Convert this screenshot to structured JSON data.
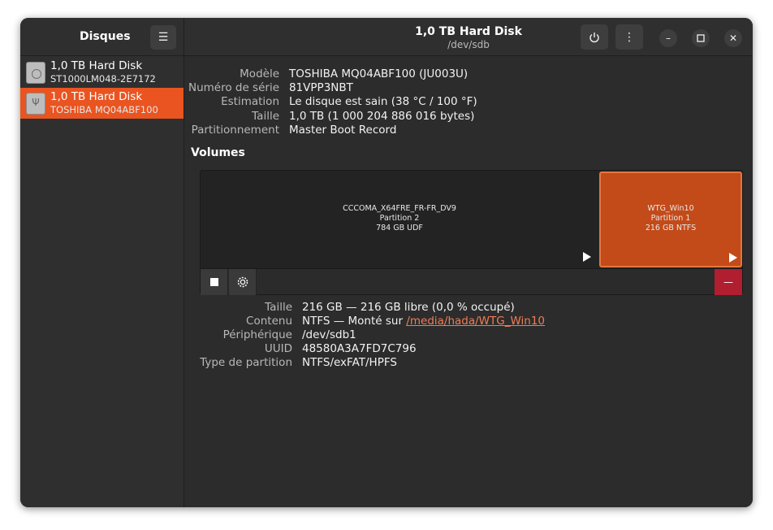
{
  "sidebar": {
    "title": "Disques",
    "menu_icon": "hamburger-icon",
    "disks": [
      {
        "name": "1,0 TB Hard Disk",
        "model": "ST1000LM048-2E7172",
        "icon": "harddisk-icon",
        "selected": false
      },
      {
        "name": "1,0 TB Hard Disk",
        "model": "TOSHIBA MQ04ABF100",
        "icon": "usb-disk-icon",
        "selected": true
      }
    ]
  },
  "header": {
    "title": "1,0 TB Hard Disk",
    "subtitle": "/dev/sdb",
    "power_icon": "power-icon",
    "menu_icon": "kebab-menu-icon",
    "minimize_icon": "minimize-icon",
    "maximize_icon": "maximize-icon",
    "close_icon": "close-icon"
  },
  "disk_info": {
    "model_label": "Modèle",
    "model_value": "TOSHIBA MQ04ABF100 (JU003U)",
    "serial_label": "Numéro de série",
    "serial_value": "81VPP3NBT",
    "assessment_label": "Estimation",
    "assessment_value": "Le disque est sain (38 °C / 100 °F)",
    "size_label": "Taille",
    "size_value": "1,0 TB (1 000 204 886 016 bytes)",
    "partitioning_label": "Partitionnement",
    "partitioning_value": "Master Boot Record"
  },
  "volumes": {
    "title": "Volumes",
    "partitions": [
      {
        "name": "CCCOMA_X64FRE_FR-FR_DV9",
        "number": "Partition 2",
        "size": "784 GB UDF",
        "selected": false
      },
      {
        "name": "WTG_Win10",
        "number": "Partition 1",
        "size": "216 GB NTFS",
        "selected": true
      }
    ],
    "toolbar": {
      "stop_icon": "stop-icon",
      "settings_icon": "gear-icon",
      "delete_icon": "minus-icon",
      "delete_glyph": "—"
    }
  },
  "partition_info": {
    "size_label": "Taille",
    "size_value": "216 GB — 216 GB libre (0,0 % occupé)",
    "content_label": "Contenu",
    "content_prefix": "NTFS — Monté sur ",
    "content_link": "/media/hada/WTG_Win10",
    "device_label": "Périphérique",
    "device_value": "/dev/sdb1",
    "uuid_label": "UUID",
    "uuid_value": "48580A3A7FD7C796",
    "type_label": "Type de partition",
    "type_value": "NTFS/exFAT/HPFS"
  },
  "colors": {
    "accent": "#e95420",
    "selected_partition": "#c34a19",
    "danger": "#b01e30"
  }
}
